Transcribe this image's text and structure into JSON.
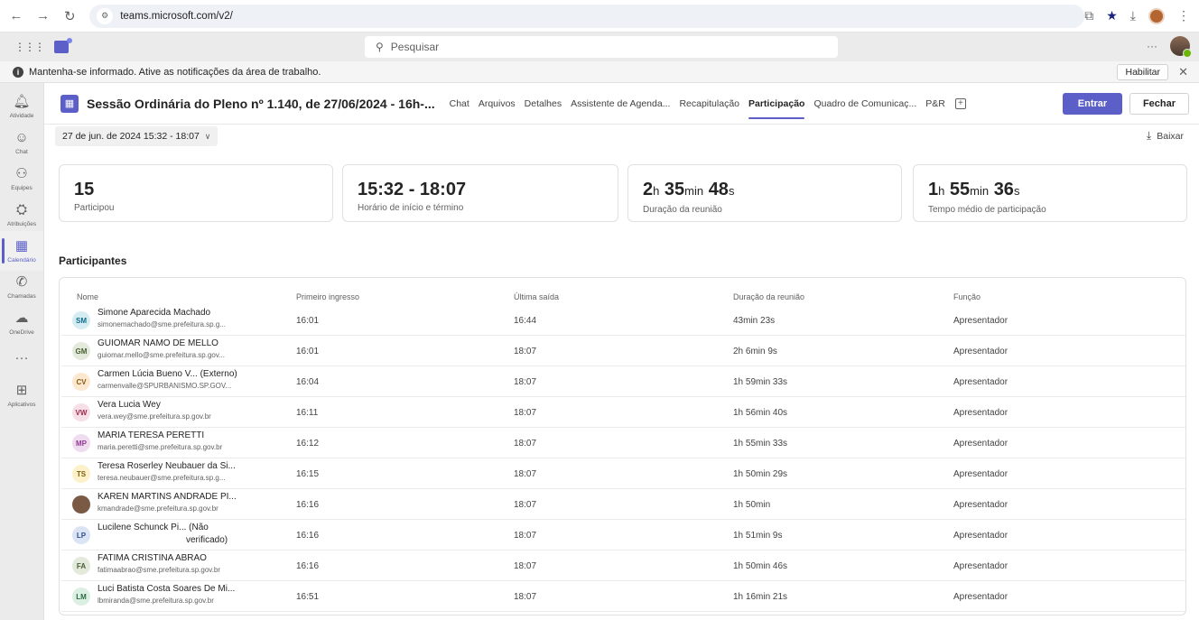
{
  "browser": {
    "url": "teams.microsoft.com/v2/"
  },
  "teams": {
    "search_placeholder": "Pesquisar"
  },
  "notification": {
    "text": "Mantenha-se informado. Ative as notificações da área de trabalho.",
    "button": "Habilitar"
  },
  "rail": [
    {
      "label": "Atividade",
      "icon": "bell-icon",
      "glyph": "🔔︎"
    },
    {
      "label": "Chat",
      "icon": "chat-icon",
      "glyph": "☺"
    },
    {
      "label": "Equipes",
      "icon": "teams-icon",
      "glyph": "⚇"
    },
    {
      "label": "Atribuições",
      "icon": "assignments-icon",
      "glyph": "⛭"
    },
    {
      "label": "Calendário",
      "icon": "calendar-icon",
      "glyph": "▦"
    },
    {
      "label": "Chamadas",
      "icon": "phone-icon",
      "glyph": "✆"
    },
    {
      "label": "OneDrive",
      "icon": "cloud-icon",
      "glyph": "☁"
    },
    {
      "label": "",
      "icon": "more-icon",
      "glyph": "···"
    },
    {
      "label": "Aplicativos",
      "icon": "apps-icon",
      "glyph": "⊞"
    }
  ],
  "meeting": {
    "title": "Sessão Ordinária do Pleno nº 1.140, de 27/06/2024 - 16h-...",
    "tabs": [
      "Chat",
      "Arquivos",
      "Detalhes",
      "Assistente de Agenda...",
      "Recapitulação",
      "Participação",
      "Quadro de Comunicaç...",
      "P&R"
    ],
    "active_tab": "Participação",
    "join_label": "Entrar",
    "close_label": "Fechar",
    "date_range": "27 de jun. de 2024 15:32 - 18:07",
    "download_label": "Baixar"
  },
  "stats": {
    "participants": {
      "value": "15",
      "label": "Participou"
    },
    "time": {
      "value": "15:32 - 18:07",
      "label": "Horário de início e término"
    },
    "duration": {
      "h": "2",
      "min": "35",
      "s": "48",
      "label": "Duração da reunião"
    },
    "average": {
      "h": "1",
      "min": "55",
      "s": "36",
      "label": "Tempo médio de participação"
    },
    "unit_h": "h",
    "unit_min": "min",
    "unit_s": "s"
  },
  "participants_title": "Participantes",
  "table": {
    "headers": {
      "name": "Nome",
      "first": "Primeiro ingresso",
      "last": "Última saída",
      "duration": "Duração da reunião",
      "role": "Função"
    },
    "rows": [
      {
        "initials": "SM",
        "name": "Simone Aparecida Machado",
        "email": "simonemachado@sme.prefeitura.sp.g...",
        "first": "16:01",
        "last": "16:44",
        "duration": "43min 23s",
        "role": "Apresentador",
        "bg": "#d6ecf3",
        "fg": "#0f6c8a"
      },
      {
        "initials": "GM",
        "name": "GUIOMAR NAMO DE MELLO",
        "email": "guiomar.mello@sme.prefeitura.sp.gov...",
        "first": "16:01",
        "last": "18:07",
        "duration": "2h 6min 9s",
        "role": "Apresentador",
        "bg": "#e3eadc",
        "fg": "#4a5e33"
      },
      {
        "initials": "CV",
        "name": "Carmen Lúcia Bueno V... (Externo)",
        "email": "carmenvalle@SPURBANISMO.SP.GOV...",
        "first": "16:04",
        "last": "18:07",
        "duration": "1h 59min 33s",
        "role": "Apresentador",
        "bg": "#fbe8cf",
        "fg": "#8a5a12"
      },
      {
        "initials": "VW",
        "name": "Vera Lucia Wey",
        "email": "vera.wey@sme.prefeitura.sp.gov.br",
        "first": "16:11",
        "last": "18:07",
        "duration": "1h 56min 40s",
        "role": "Apresentador",
        "bg": "#f6dfe6",
        "fg": "#9b2c4d"
      },
      {
        "initials": "MP",
        "name": "MARIA TERESA PERETTI",
        "email": "maria.peretti@sme.prefeitura.sp.gov.br",
        "first": "16:12",
        "last": "18:07",
        "duration": "1h 55min 33s",
        "role": "Apresentador",
        "bg": "#f0dcf0",
        "fg": "#8e3b8e"
      },
      {
        "initials": "TS",
        "name": "Teresa Roserley Neubauer da Si...",
        "email": "teresa.neubauer@sme.prefeitura.sp.g...",
        "first": "16:15",
        "last": "18:07",
        "duration": "1h 50min 29s",
        "role": "Apresentador",
        "bg": "#fdf1c9",
        "fg": "#7a6010"
      },
      {
        "initials": "",
        "name": "KAREN MARTINS ANDRADE PI...",
        "email": "kmandrade@sme.prefeitura.sp.gov.br",
        "first": "16:16",
        "last": "18:07",
        "duration": "1h 50min",
        "role": "Apresentador",
        "bg": "#7a5a45",
        "fg": "#ffffff"
      },
      {
        "initials": "LP",
        "name": "Lucilene Schunck Pi... (Não",
        "name2": "verificado)",
        "email": "",
        "first": "16:16",
        "last": "18:07",
        "duration": "1h 51min 9s",
        "role": "Apresentador",
        "bg": "#dbe4f5",
        "fg": "#2f4f8f"
      },
      {
        "initials": "FA",
        "name": "FATIMA CRISTINA ABRAO",
        "email": "fatimaabrao@sme.prefeitura.sp.gov.br",
        "first": "16:16",
        "last": "18:07",
        "duration": "1h 50min 46s",
        "role": "Apresentador",
        "bg": "#e3eadc",
        "fg": "#4a5e33"
      },
      {
        "initials": "LM",
        "name": "Luci Batista Costa Soares De Mi...",
        "email": "lbmiranda@sme.prefeitura.sp.gov.br",
        "first": "16:51",
        "last": "18:07",
        "duration": "1h 16min 21s",
        "role": "Apresentador",
        "bg": "#dcefe3",
        "fg": "#2f6b45"
      }
    ]
  }
}
